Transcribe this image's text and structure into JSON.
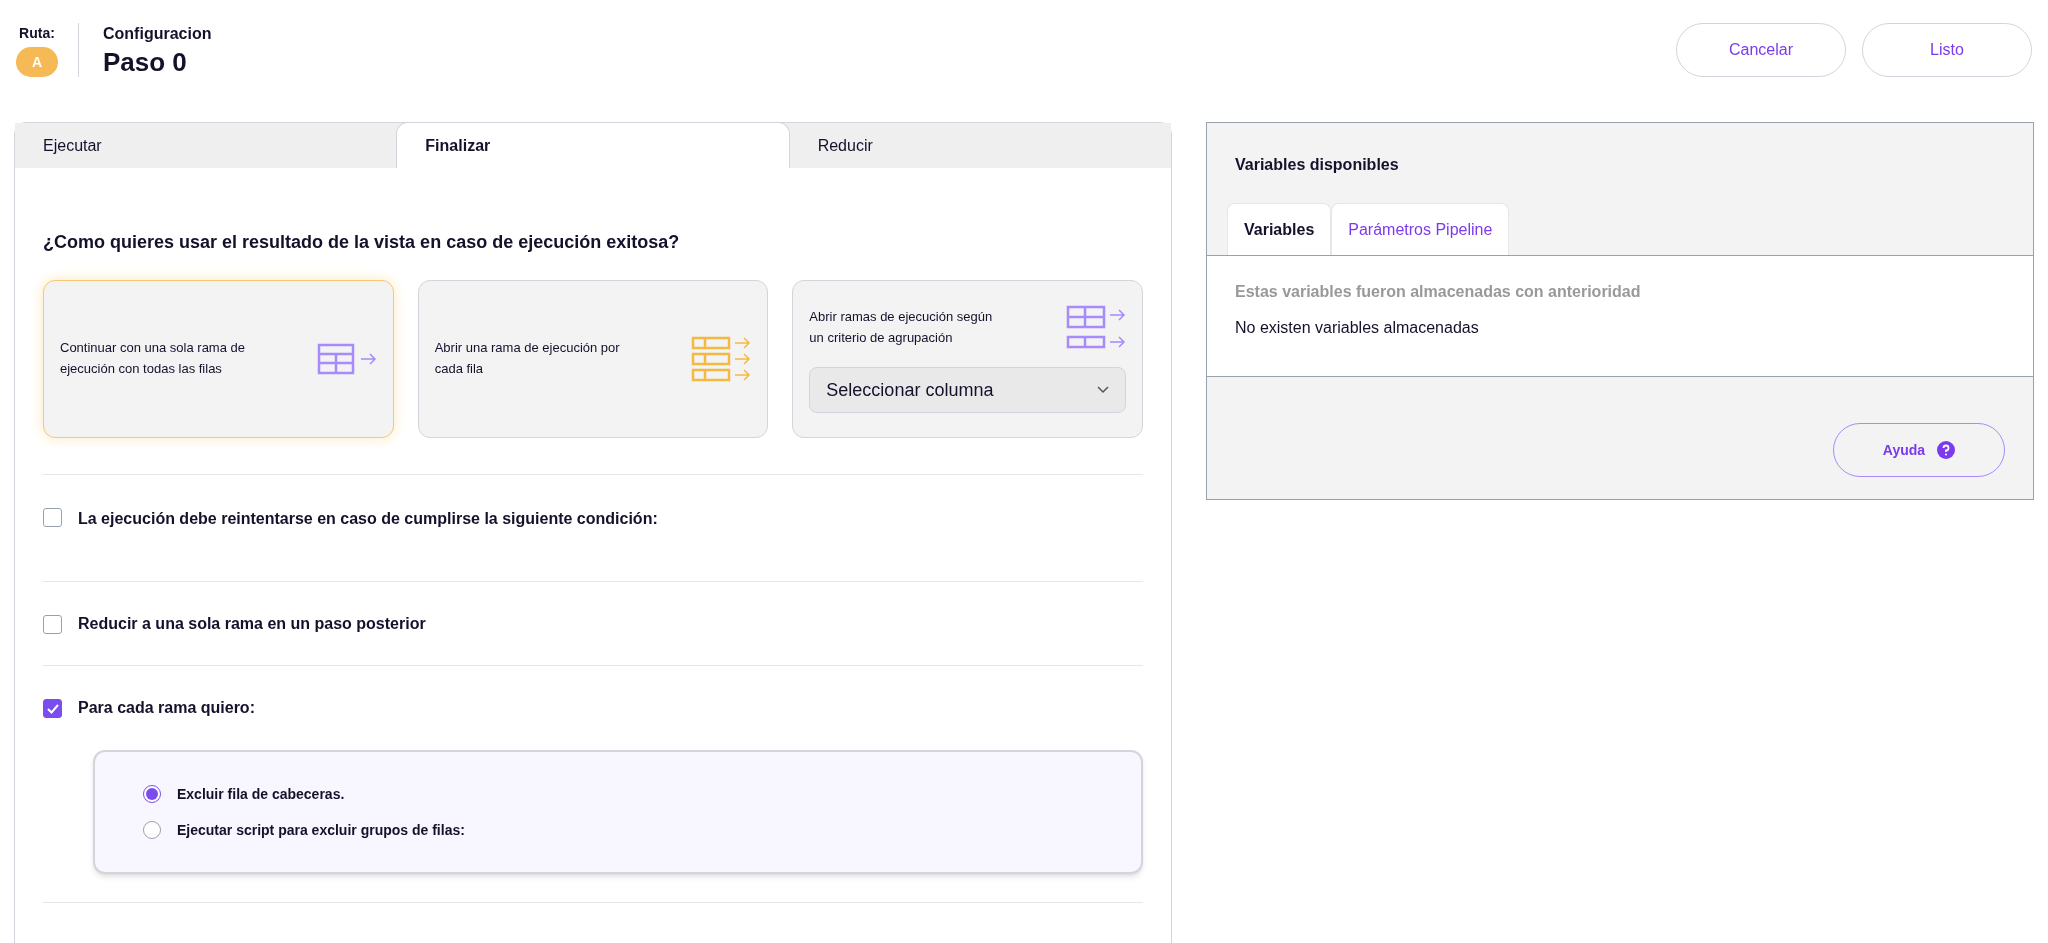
{
  "header": {
    "route_label": "Ruta:",
    "route_badge": "A",
    "subtitle": "Configuracion",
    "title": "Paso 0",
    "buttons": [
      "Cancelar",
      "Listo"
    ]
  },
  "tabs": [
    {
      "label": "Ejecutar",
      "selected": false
    },
    {
      "label": "Finalizar",
      "selected": true
    },
    {
      "label": "Reducir",
      "selected": false
    }
  ],
  "question": "¿Como quieres usar el resultado de la vista en caso de ejecución exitosa?",
  "options": [
    {
      "kind": "single",
      "label": "Continuar con una sola rama de ejecución con todas las filas",
      "selected": true
    },
    {
      "kind": "per_row",
      "label": "Abrir una rama de ejecución por cada fila",
      "selected": false
    },
    {
      "kind": "grouped",
      "label": "Abrir ramas de ejecución según un criterio de agrupación",
      "selected": false,
      "select_placeholder": "Seleccionar columna"
    }
  ],
  "checks": [
    {
      "label": "La ejecución debe reintentarse en caso de cumplirse la siguiente condición:",
      "checked": false
    },
    {
      "label": "Reducir a una sola rama en un paso posterior",
      "checked": false
    },
    {
      "label": "Para cada rama quiero:",
      "checked": true
    }
  ],
  "radios": [
    {
      "label": "Excluir fila de cabeceras.",
      "selected": true
    },
    {
      "label": "Ejecutar script para excluir grupos de filas:",
      "selected": false
    }
  ],
  "variables_panel": {
    "title": "Variables disponibles",
    "tabs": [
      {
        "label": "Variables",
        "selected": true
      },
      {
        "label": "Parámetros Pipeline",
        "selected": false
      }
    ],
    "hint": "Estas variables fueron almacenadas con anterioridad",
    "empty": "No existen variables almacenadas",
    "help_button": "Ayuda"
  }
}
